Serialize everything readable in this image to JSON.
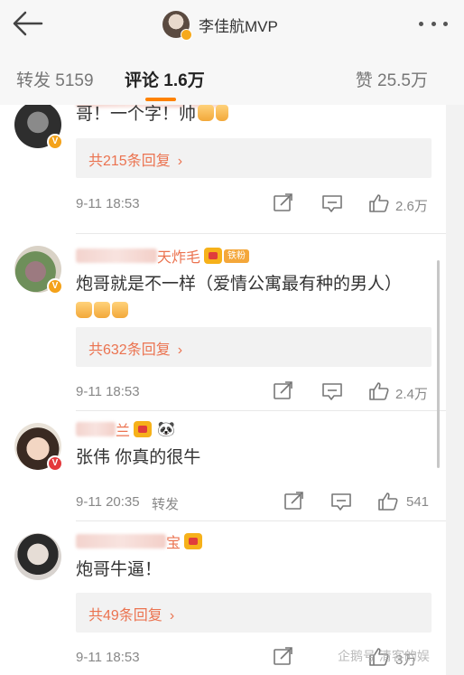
{
  "header": {
    "title": "李佳航MVP",
    "back_icon": "arrow-left-icon",
    "more_icon": "more-dots-icon"
  },
  "tabs": {
    "repost": "转发 5159",
    "comment": "评论 1.6万",
    "like": "赞 25.5万",
    "active_color": "#ff8200"
  },
  "comments": [
    {
      "name_suffix": "",
      "text": "哥！一个字！帅",
      "reply_count": "共215条回复",
      "time": "9-11 18:53",
      "likes": "2.6万"
    },
    {
      "name_suffix": "天炸毛",
      "fan_badge": "铁粉",
      "text_line1": "炮哥就是不一样（爱情公寓最有种的男人）",
      "reply_count": "共632条回复",
      "time": "9-11 18:53",
      "likes": "2.4万"
    },
    {
      "name_suffix": "兰",
      "text": "张伟 你真的很牛",
      "time": "9-11 20:35",
      "repost_label": "转发",
      "likes": "541"
    },
    {
      "name_suffix": "宝",
      "text": "炮哥牛逼！",
      "reply_count": "共49条回复",
      "time": "9-11 18:53",
      "likes": "3万"
    }
  ],
  "icons": {
    "share": "share-icon",
    "comment": "comment-icon",
    "like": "thumbs-up-icon"
  },
  "watermark": "企鹅号 清客的娱",
  "colors": {
    "name": "#eb7350",
    "link": "#eb7350",
    "muted": "#888888"
  }
}
